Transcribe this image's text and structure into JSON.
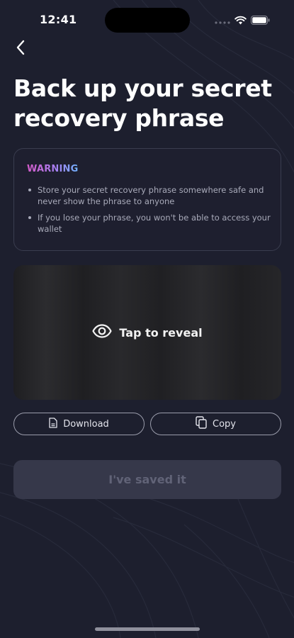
{
  "status_bar": {
    "time": "12:41",
    "icons": [
      "signal-dots-icon",
      "wifi-icon",
      "battery-icon"
    ]
  },
  "header": {
    "back_icon": "chevron-left-icon",
    "title": "Back up your secret recovery phrase"
  },
  "warning": {
    "title": "WARNING",
    "items": [
      "Store your secret recovery phrase somewhere safe and never show the phrase to anyone",
      "If you lose your phrase, you won't be able to access your wallet"
    ]
  },
  "reveal": {
    "icon": "eye-icon",
    "label": "Tap to reveal"
  },
  "actions": {
    "download_label": "Download",
    "download_icon": "document-icon",
    "copy_label": "Copy",
    "copy_icon": "copy-icon"
  },
  "primary": {
    "saved_label": "I've saved it",
    "enabled": false
  },
  "colors": {
    "background": "#1d1f2e",
    "card_border": "#3a3d4f",
    "warning_gradient": [
      "#d45bc9",
      "#a77ef0",
      "#6fb4ff"
    ],
    "disabled_button": "#36384a"
  }
}
